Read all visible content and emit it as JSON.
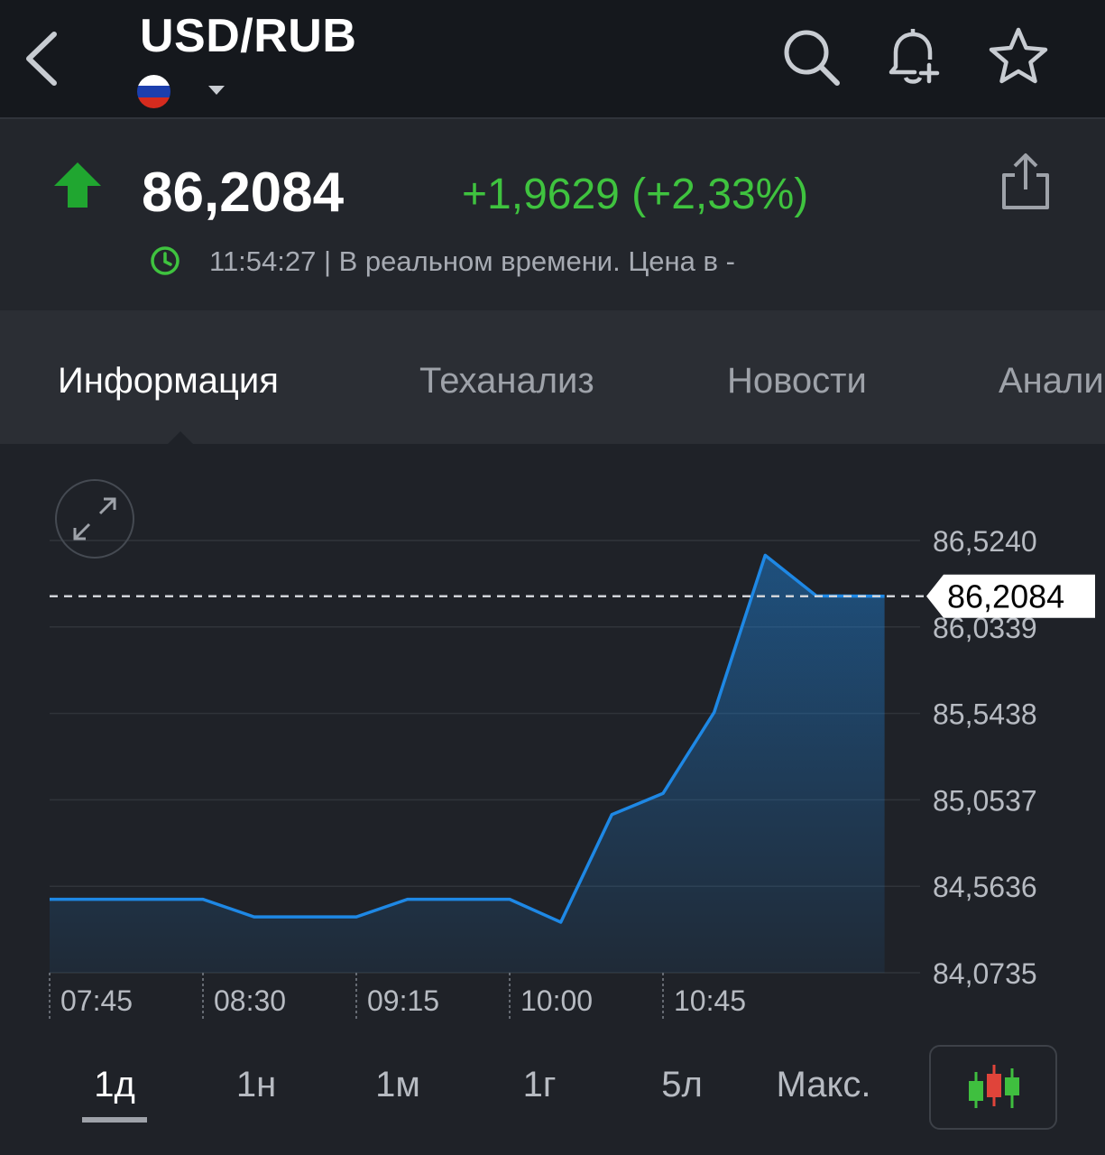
{
  "header": {
    "pair_title": "USD/RUB",
    "back_icon": "chevron-left-icon",
    "flag_icon": "russia-flag-icon",
    "dropdown_icon": "caret-down-icon",
    "search_icon": "search-icon",
    "alert_icon": "bell-plus-icon",
    "watchlist_icon": "star-icon"
  },
  "quote": {
    "price": "86,2084",
    "change": "+1,9629 (+2,33%)",
    "direction": "up",
    "up_color": "#3fc33f",
    "time_status": "11:54:27 | В реальном времени. Цена в -"
  },
  "tabs": [
    {
      "label": "Информация",
      "active": true
    },
    {
      "label": "Теханализ",
      "active": false
    },
    {
      "label": "Новости",
      "active": false
    },
    {
      "label": "Анали",
      "active": false
    }
  ],
  "range_buttons": [
    {
      "label": "1д",
      "active": true
    },
    {
      "label": "1н",
      "active": false
    },
    {
      "label": "1м",
      "active": false
    },
    {
      "label": "1г",
      "active": false
    },
    {
      "label": "5л",
      "active": false
    },
    {
      "label": "Макс.",
      "active": false
    }
  ],
  "chart_data": {
    "type": "area",
    "line_color": "#1e88e5",
    "x": [
      "07:45",
      "08:00",
      "08:15",
      "08:30",
      "08:45",
      "09:00",
      "09:15",
      "09:30",
      "09:45",
      "10:00",
      "10:15",
      "10:30",
      "10:45",
      "11:00",
      "11:15",
      "11:30",
      "11:45"
    ],
    "y": [
      84.49,
      84.49,
      84.49,
      84.49,
      84.39,
      84.39,
      84.39,
      84.49,
      84.49,
      84.49,
      84.36,
      84.97,
      85.09,
      85.55,
      86.44,
      86.21
    ],
    "x_extra_points": [
      {
        "x": "11:50",
        "y": 86.2084
      }
    ],
    "xticks": [
      "07:45",
      "08:30",
      "09:15",
      "10:00",
      "10:45"
    ],
    "yticks": [
      "86,5240",
      "86,0339",
      "85,5438",
      "85,0537",
      "84,5636",
      "84,0735"
    ],
    "ylim": [
      84.0735,
      86.524
    ],
    "current_value_label": "86,2084",
    "current_value": 86.2084,
    "grid": true
  },
  "chart_controls": {
    "expand_icon": "expand-arrows-icon",
    "candlestick_icon": "candlestick-icon"
  }
}
